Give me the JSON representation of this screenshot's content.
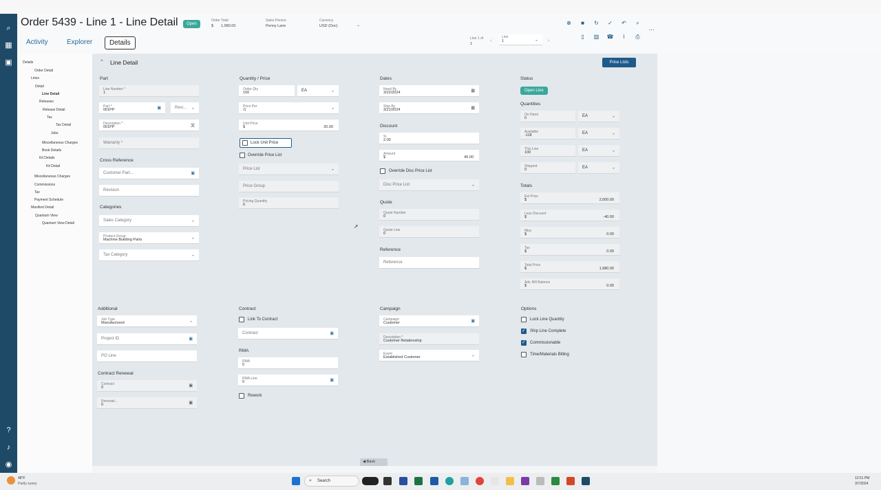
{
  "header": {
    "title": "Order 5439 - Line 1 - Line Detail",
    "status_badge": "Open",
    "order_total_label": "Order Total",
    "order_total_currency": "$",
    "order_total_value": "1,980.00",
    "sales_person_label": "Sales Person",
    "sales_person_value": "Penny Lane",
    "currency_label": "Currency",
    "currency_value": "USD (Doc)",
    "line_of_label": "Line 1 of",
    "line_of_value": "1",
    "line_field_label": "Line",
    "line_field_value": "1"
  },
  "tabs": [
    "Activity",
    "Explorer",
    "Details"
  ],
  "tree": [
    "Details",
    "Order Detail",
    "Lines",
    "Detail",
    "Line Detail",
    "Releases",
    "Release Detail",
    "Tax",
    "Tax Detail",
    "Jobs",
    "Miscellaneous Charges",
    "Book Details",
    "Kit Details",
    "Kit Detail",
    "Miscellaneous Charges",
    "Commissions",
    "Tax",
    "Payment Schedule",
    "Manifest Detail",
    "Quantum View",
    "Quantum View Detail"
  ],
  "panel": {
    "title": "Line Detail",
    "price_lists_button": "Price Lists",
    "back_button": "Back"
  },
  "part": {
    "heading": "Part",
    "line_number_label": "Line Number *",
    "line_number_value": "1",
    "part_label": "Part *",
    "part_value": "001PP",
    "revision_placeholder": "Revi...",
    "description_label": "Description *",
    "description_value": "001PP",
    "warranty_placeholder": "Warranty *",
    "cross_reference_heading": "Cross Reference",
    "customer_part_placeholder": "Customer Part...",
    "revision2_placeholder": "Revision",
    "categories_heading": "Categories",
    "sales_category_placeholder": "Sales Category",
    "product_group_label": "Product Group",
    "product_group_value": "Machine Building Parts",
    "tax_category_placeholder": "Tax Category"
  },
  "qty": {
    "heading": "Quantity / Price",
    "order_qty_label": "Order Qty",
    "order_qty_value": "100",
    "uom_value": "EA",
    "price_per_label": "Price Per",
    "price_per_value": "/1",
    "unit_price_label": "Unit Price",
    "unit_price_currency": "$",
    "unit_price_value": "20.00",
    "lock_unit_price": "Lock Unit Price",
    "override_price_list": "Override Price List",
    "price_list_placeholder": "Price List",
    "price_group_placeholder": "Price Group",
    "pricing_quantity_label": "Pricing Quantity",
    "pricing_quantity_value": "0"
  },
  "dates": {
    "heading": "Dates",
    "need_by_label": "Need By",
    "need_by_value": "3/22/2024",
    "ship_by_label": "Ship By",
    "ship_by_value": "3/21/2024",
    "discount_heading": "Discount",
    "pct_label": "%",
    "pct_value": "2.00",
    "amount_label": "Amount",
    "amount_currency": "$",
    "amount_value": "40.00",
    "override_disc": "Override Disc Price List",
    "disc_price_list_placeholder": "Disc Price List",
    "quote_heading": "Quote",
    "quote_number_label": "Quote Number",
    "quote_number_value": "0",
    "quote_line_label": "Quote Line",
    "quote_line_value": "0",
    "reference_heading": "Reference",
    "reference_placeholder": "Reference"
  },
  "status": {
    "heading": "Status",
    "badge": "Open Line",
    "quantities_heading": "Quantities",
    "on_hand_label": "On Hand",
    "on_hand_value": "0",
    "available_label": "Available",
    "available_value": "-118",
    "this_line_label": "This Line",
    "this_line_value": "100",
    "shipped_label": "Shipped",
    "shipped_value": "0",
    "uom": "EA",
    "totals_heading": "Totals",
    "totals": [
      {
        "label": "Ext Price",
        "value": "2,000.00"
      },
      {
        "label": "Less Discount",
        "value": "-40.00"
      },
      {
        "label": "Misc",
        "value": "0.00"
      },
      {
        "label": "Tax",
        "value": "0.00"
      },
      {
        "label": "Total Price",
        "value": "1,980.00"
      },
      {
        "label": "Adv. Bill Balance",
        "value": "0.00"
      }
    ],
    "currency": "$"
  },
  "additional": {
    "heading": "Additional",
    "job_type_label": "Job Type",
    "job_type_value": "Manufactured",
    "project_id_placeholder": "Project ID",
    "po_line_placeholder": "PO Line",
    "renewal_heading": "Contract Renewal",
    "contract_label": "Contract",
    "contract_value": "0",
    "renewal_label": "Renewal...",
    "renewal_value": "0"
  },
  "contract": {
    "heading": "Contract",
    "link_to_contract": "Link To Contract",
    "contract_placeholder": "Contract",
    "rma_heading": "RMA",
    "rma_label": "RMA",
    "rma_value": "0",
    "rma_line_label": "RMA Line",
    "rma_line_value": "0",
    "rework": "Rework"
  },
  "campaign": {
    "heading": "Campaign",
    "campaign_label": "Campaign",
    "campaign_value": "Customer",
    "description_label": "Description *",
    "description_value": "Customer Relationship",
    "event_label": "Event",
    "event_value": "Established Customer"
  },
  "options": {
    "heading": "Options",
    "items": [
      {
        "label": "Lock Line Quantity",
        "checked": false
      },
      {
        "label": "Ship Line Complete",
        "checked": true
      },
      {
        "label": "Commissionable",
        "checked": true
      },
      {
        "label": "Time/Materials Billing",
        "checked": false
      }
    ]
  },
  "taskbar": {
    "weather_temp": "48°F",
    "weather_desc": "Partly sunny",
    "search_label": "Search",
    "time": "12:51 PM",
    "date": "3/7/2024"
  },
  "colors": {
    "rail": "#1e4a68",
    "accent": "#1e5a8a",
    "badge": "#3aa89a",
    "panel": "#e3e8ec"
  }
}
